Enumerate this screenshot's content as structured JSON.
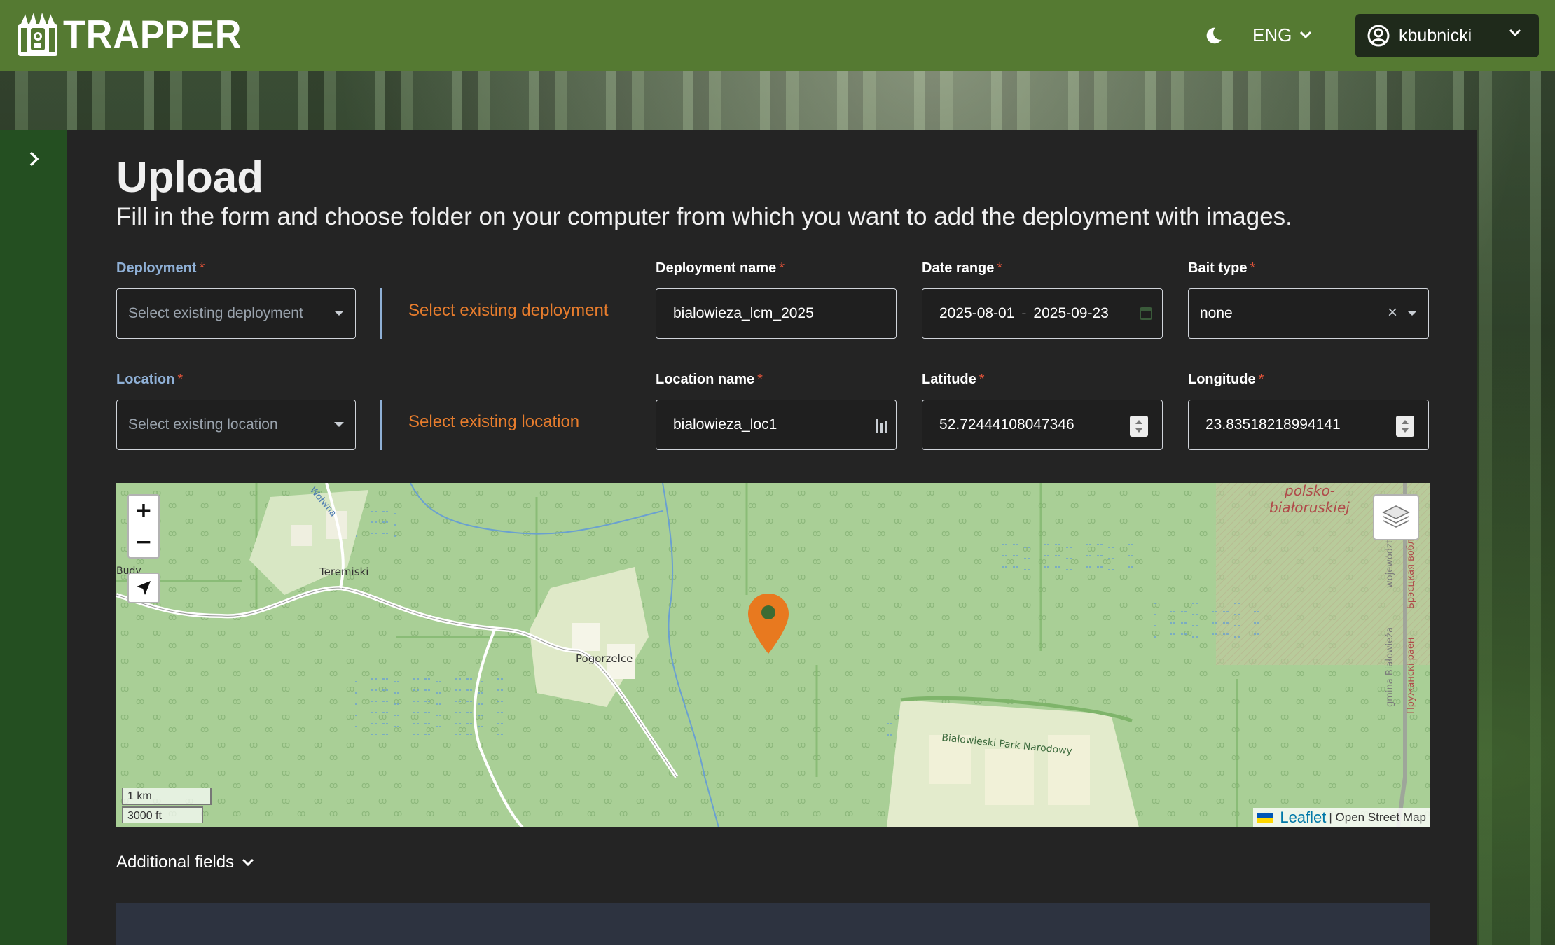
{
  "header": {
    "brand": "TRAPPER",
    "language": "ENG",
    "username": "kbubnicki"
  },
  "page": {
    "title": "Upload",
    "subtitle": "Fill in the form and choose folder on your computer from which you want to add the deployment with images."
  },
  "form": {
    "deployment": {
      "label": "Deployment",
      "placeholder": "Select existing deployment",
      "link": "Select existing deployment"
    },
    "deployment_name": {
      "label": "Deployment name",
      "value": "bialowieza_lcm_2025"
    },
    "date_range": {
      "label": "Date range",
      "start": "2025-08-01",
      "separator": "-",
      "end": "2025-09-23"
    },
    "bait_type": {
      "label": "Bait type",
      "value": "none"
    },
    "location": {
      "label": "Location",
      "placeholder": "Select existing location",
      "link": "Select existing location"
    },
    "location_name": {
      "label": "Location name",
      "value": "bialowieza_loc1"
    },
    "latitude": {
      "label": "Latitude",
      "value": "52.72444108047346"
    },
    "longitude": {
      "label": "Longitude",
      "value": "23.83518218994141"
    },
    "required_mark": "*"
  },
  "map": {
    "zoom_in": "+",
    "zoom_out": "−",
    "places": {
      "teremiski": "Teremiski",
      "pogorzelce": "Pogorzelce",
      "park": "Białowieski Park Narodowy",
      "border_1": "polsko-",
      "border_2": "białoruskiej",
      "budy": "Budy",
      "river": "Wołwna",
      "gmina": "gmina Białowieża",
      "wojewodztwo": "województwo",
      "brest": "Брэсцкая вобласць",
      "pruzhany": "Пружанскі раён"
    },
    "scale_km": "1 km",
    "scale_ft": "3000 ft",
    "attribution_link": "Leaflet",
    "attribution_text": "| Open Street Map",
    "marker_color": "#e8791f"
  },
  "additional_fields_label": "Additional fields",
  "colors": {
    "header": "#557a32",
    "sidebar": "#244f21",
    "panel": "#242424",
    "accent_link": "#e87d2d",
    "label_blue": "#8fb0d6"
  }
}
